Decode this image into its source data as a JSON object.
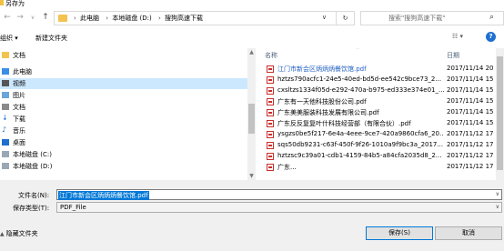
{
  "window": {
    "title": "另存为"
  },
  "address": {
    "crumbs": [
      "此电脑",
      "本地磁盘 (D:)",
      "搜狗高速下载"
    ],
    "search_placeholder": "搜索\"搜狗高速下载\""
  },
  "toolbar": {
    "organize": "组织 ▾",
    "new_folder": "新建文件夹"
  },
  "nav": {
    "items": [
      {
        "label": "文档",
        "icon": "folder-icon"
      },
      {
        "label": "此电脑",
        "icon": "computer-icon"
      },
      {
        "label": "视频",
        "icon": "video-icon",
        "selected": true
      },
      {
        "label": "图片",
        "icon": "picture-icon"
      },
      {
        "label": "文档",
        "icon": "document-icon"
      },
      {
        "label": "下载",
        "icon": "download-icon"
      },
      {
        "label": "音乐",
        "icon": "music-icon"
      },
      {
        "label": "桌面",
        "icon": "desktop-icon"
      },
      {
        "label": "本地磁盘 (C:)",
        "icon": "drive-icon"
      },
      {
        "label": "本地磁盘 (D:)",
        "icon": "drive-icon"
      }
    ]
  },
  "files": {
    "col_name": "名称",
    "col_date": "日期",
    "rows": [
      {
        "name": "江门市新会区炳炳炳餐饮馆.pdf",
        "date": "2017/11/14 20",
        "link": true
      },
      {
        "name": "hztzs790acfc1-24e5-40ed-bd5d-ee542c9bce73_2...",
        "date": "2017/11/14 15"
      },
      {
        "name": "cxsltzs1334f05d-e292-470a-b975-ed333e374e01_...",
        "date": "2017/11/14 15"
      },
      {
        "name": "广东有一天他科技股份公司.pdf",
        "date": "2017/11/14 15"
      },
      {
        "name": "广东美美服装科技发展有限公司.pdf",
        "date": "2017/11/14 15"
      },
      {
        "name": "广东反反复复叶什科技经营部（有限合伙）.pdf",
        "date": "2017/11/14 15"
      },
      {
        "name": "ysgzs0be5f217-6e4a-4eee-9ce7-420a9860cfa6_20...",
        "date": "2017/11/12 17"
      },
      {
        "name": "sqs50db9231-c63f-450f-9f26-1010a9f9bc3a_2017...",
        "date": "2017/11/12 17"
      },
      {
        "name": "hztzsc9c39a01-cdb1-4159-84b5-a84cfa2035d8_2...",
        "date": "2017/11/12 17"
      },
      {
        "name": "广东...",
        "date": "2017/11/12 17"
      }
    ]
  },
  "form": {
    "filename_label": "文件名(N):",
    "filename_value": "江门市新会区炳炳炳餐饮馆.pdf",
    "filetype_label": "保存类型(T):",
    "filetype_value": "PDF_File",
    "hide_folders": "隐藏文件夹",
    "save": "保存(S)",
    "cancel": "取消"
  }
}
